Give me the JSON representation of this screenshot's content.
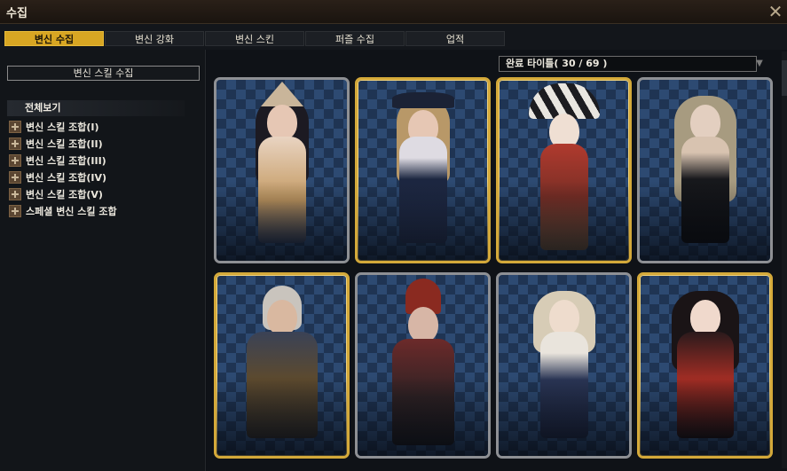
{
  "window": {
    "title": "수집",
    "close_glyph": "✕"
  },
  "tabs": [
    {
      "label": "변신 수집",
      "active": true
    },
    {
      "label": "변신 강화",
      "active": false
    },
    {
      "label": "변신 스킨",
      "active": false
    },
    {
      "label": "퍼즐 수집",
      "active": false
    },
    {
      "label": "업적",
      "active": false
    }
  ],
  "sidebar": {
    "collection_button": "변신 스킬 수집",
    "all_label": "전체보기",
    "items": [
      {
        "label": "변신 스킬 조합(I)"
      },
      {
        "label": "변신 스킬 조합(II)"
      },
      {
        "label": "변신 스킬 조합(III)"
      },
      {
        "label": "변신 스킬 조합(IV)"
      },
      {
        "label": "변신 스킬 조합(V)"
      },
      {
        "label": "스페셜 변신 스킬 조합"
      }
    ]
  },
  "filter": {
    "selected": "완료 타이틀( 30 / 69 )",
    "arrow_icon": "triangle-down-icon"
  },
  "cards": [
    {
      "frame": "grey",
      "character": "fox-ear-girl-portrait"
    },
    {
      "frame": "gold",
      "character": "musketeer-girl-portrait"
    },
    {
      "frame": "gold",
      "character": "jester-portrait"
    },
    {
      "frame": "grey",
      "character": "dark-sorceress-portrait"
    },
    {
      "frame": "gold",
      "character": "old-warrior-portrait"
    },
    {
      "frame": "grey",
      "character": "red-plume-knight-portrait"
    },
    {
      "frame": "grey",
      "character": "winged-girl-portrait"
    },
    {
      "frame": "gold",
      "character": "red-twin-tail-girl-portrait"
    }
  ],
  "colors": {
    "accent": "#d8a623",
    "gold_frame": "#d4a93a",
    "grey_frame": "#8e9094"
  }
}
